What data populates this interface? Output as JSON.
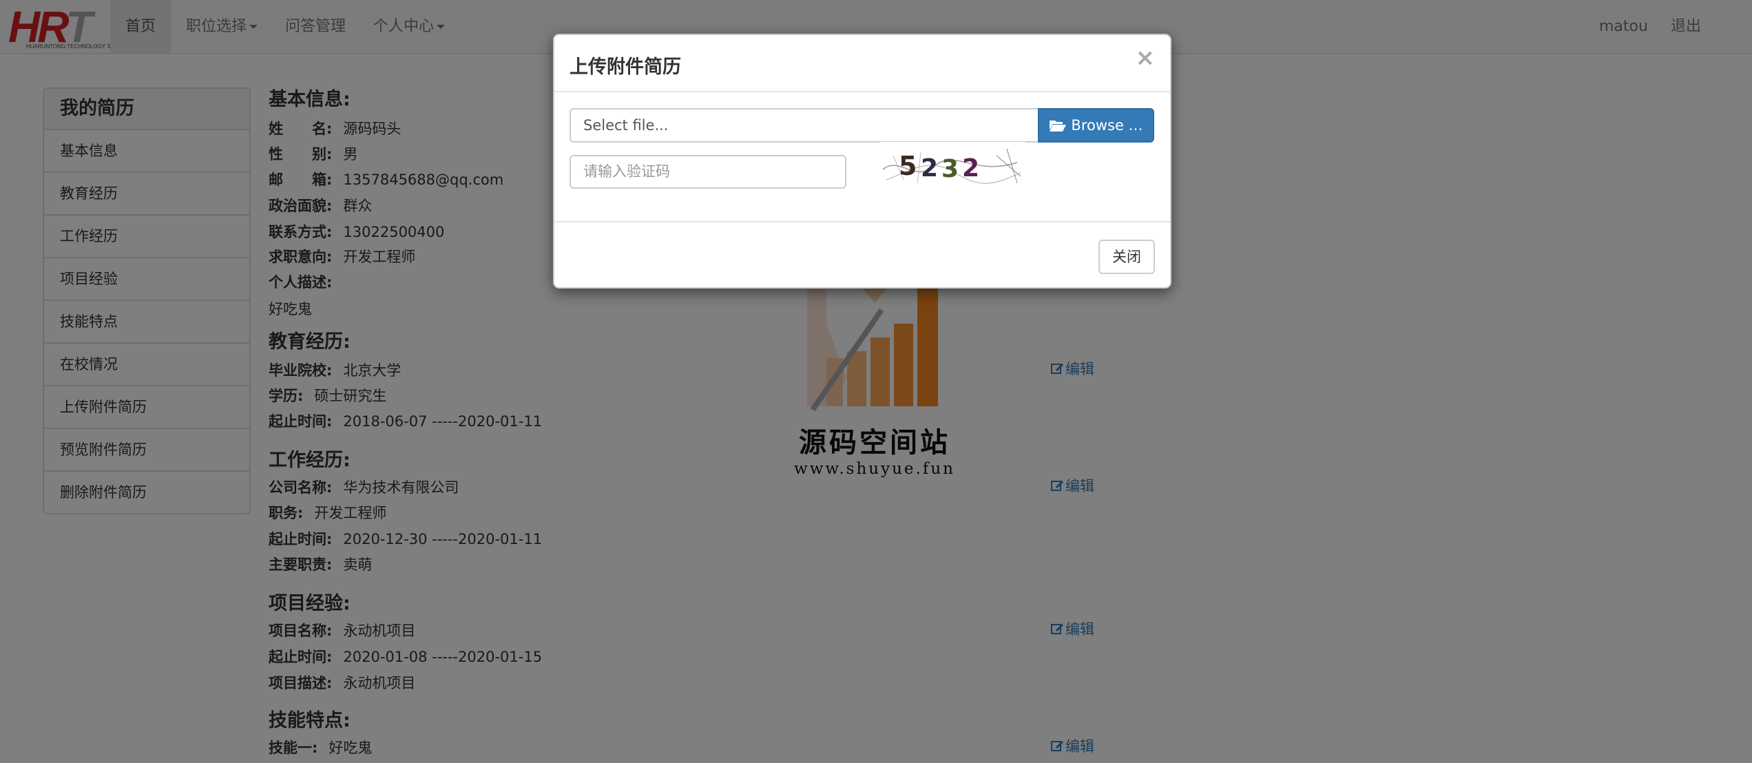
{
  "navbar": {
    "logo_text_red": "HR",
    "logo_text_gray": "T",
    "logo_subtext": "HUARUNTONG TECHNOLOGY 华汇通科技",
    "items": [
      {
        "label": "首页",
        "active": true
      },
      {
        "label": "职位选择",
        "dropdown": true
      },
      {
        "label": "问答管理"
      },
      {
        "label": "个人中心",
        "dropdown": true
      }
    ],
    "user": "matou",
    "logout": "退出"
  },
  "sidebar": {
    "title": "我的简历",
    "items": [
      "基本信息",
      "教育经历",
      "工作经历",
      "项目经验",
      "技能特点",
      "在校情况",
      "上传附件简历",
      "预览附件简历",
      "删除附件简历"
    ]
  },
  "basic": {
    "title": "基本信息:",
    "name_label": "姓　　名:",
    "name": "源码码头",
    "gender_label": "性　　别:",
    "gender": "男",
    "email_label": "邮　　箱:",
    "email": "1357845688@qq.com",
    "politics_label": "政治面貌:",
    "politics": "群众",
    "phone_label": "联系方式:",
    "phone": "13022500400",
    "intent_label": "求职意向:",
    "intent": "开发工程师",
    "desc_label": "个人描述:",
    "desc": "好吃鬼"
  },
  "education": {
    "title": "教育经历:",
    "school_label": "毕业院校:",
    "school": "北京大学",
    "degree_label": "学历:",
    "degree": "硕士研究生",
    "period_label": "起止时间:",
    "period": "2018-06-07 -----2020-01-11"
  },
  "work": {
    "title": "工作经历:",
    "company_label": "公司名称:",
    "company": "华为技术有限公司",
    "role_label": "职务:",
    "role": "开发工程师",
    "period_label": "起止时间:",
    "period": "2020-12-30 -----2020-01-11",
    "duty_label": "主要职责:",
    "duty": "卖萌"
  },
  "project": {
    "title": "项目经验:",
    "name_label": "项目名称:",
    "name": "永动机项目",
    "period_label": "起止时间:",
    "period": "2020-01-08 -----2020-01-15",
    "desc_label": "项目描述:",
    "desc": "永动机项目"
  },
  "skills": {
    "title": "技能特点:",
    "skill1_label": "技能一:",
    "skill1": "好吃鬼"
  },
  "edit_label": "编辑",
  "watermark": {
    "title": "源码空间站",
    "url": "www.shuyue.fun"
  },
  "modal": {
    "title": "上传附件简历",
    "close_symbol": "×",
    "file_placeholder": "Select file...",
    "browse_label": "Browse …",
    "captcha_placeholder": "请输入验证码",
    "captcha_text": "5232",
    "close_button": "关闭"
  },
  "colors": {
    "primary": "#337ab7",
    "brand_red": "#d32027",
    "watermark_orange": "#f5861f"
  }
}
